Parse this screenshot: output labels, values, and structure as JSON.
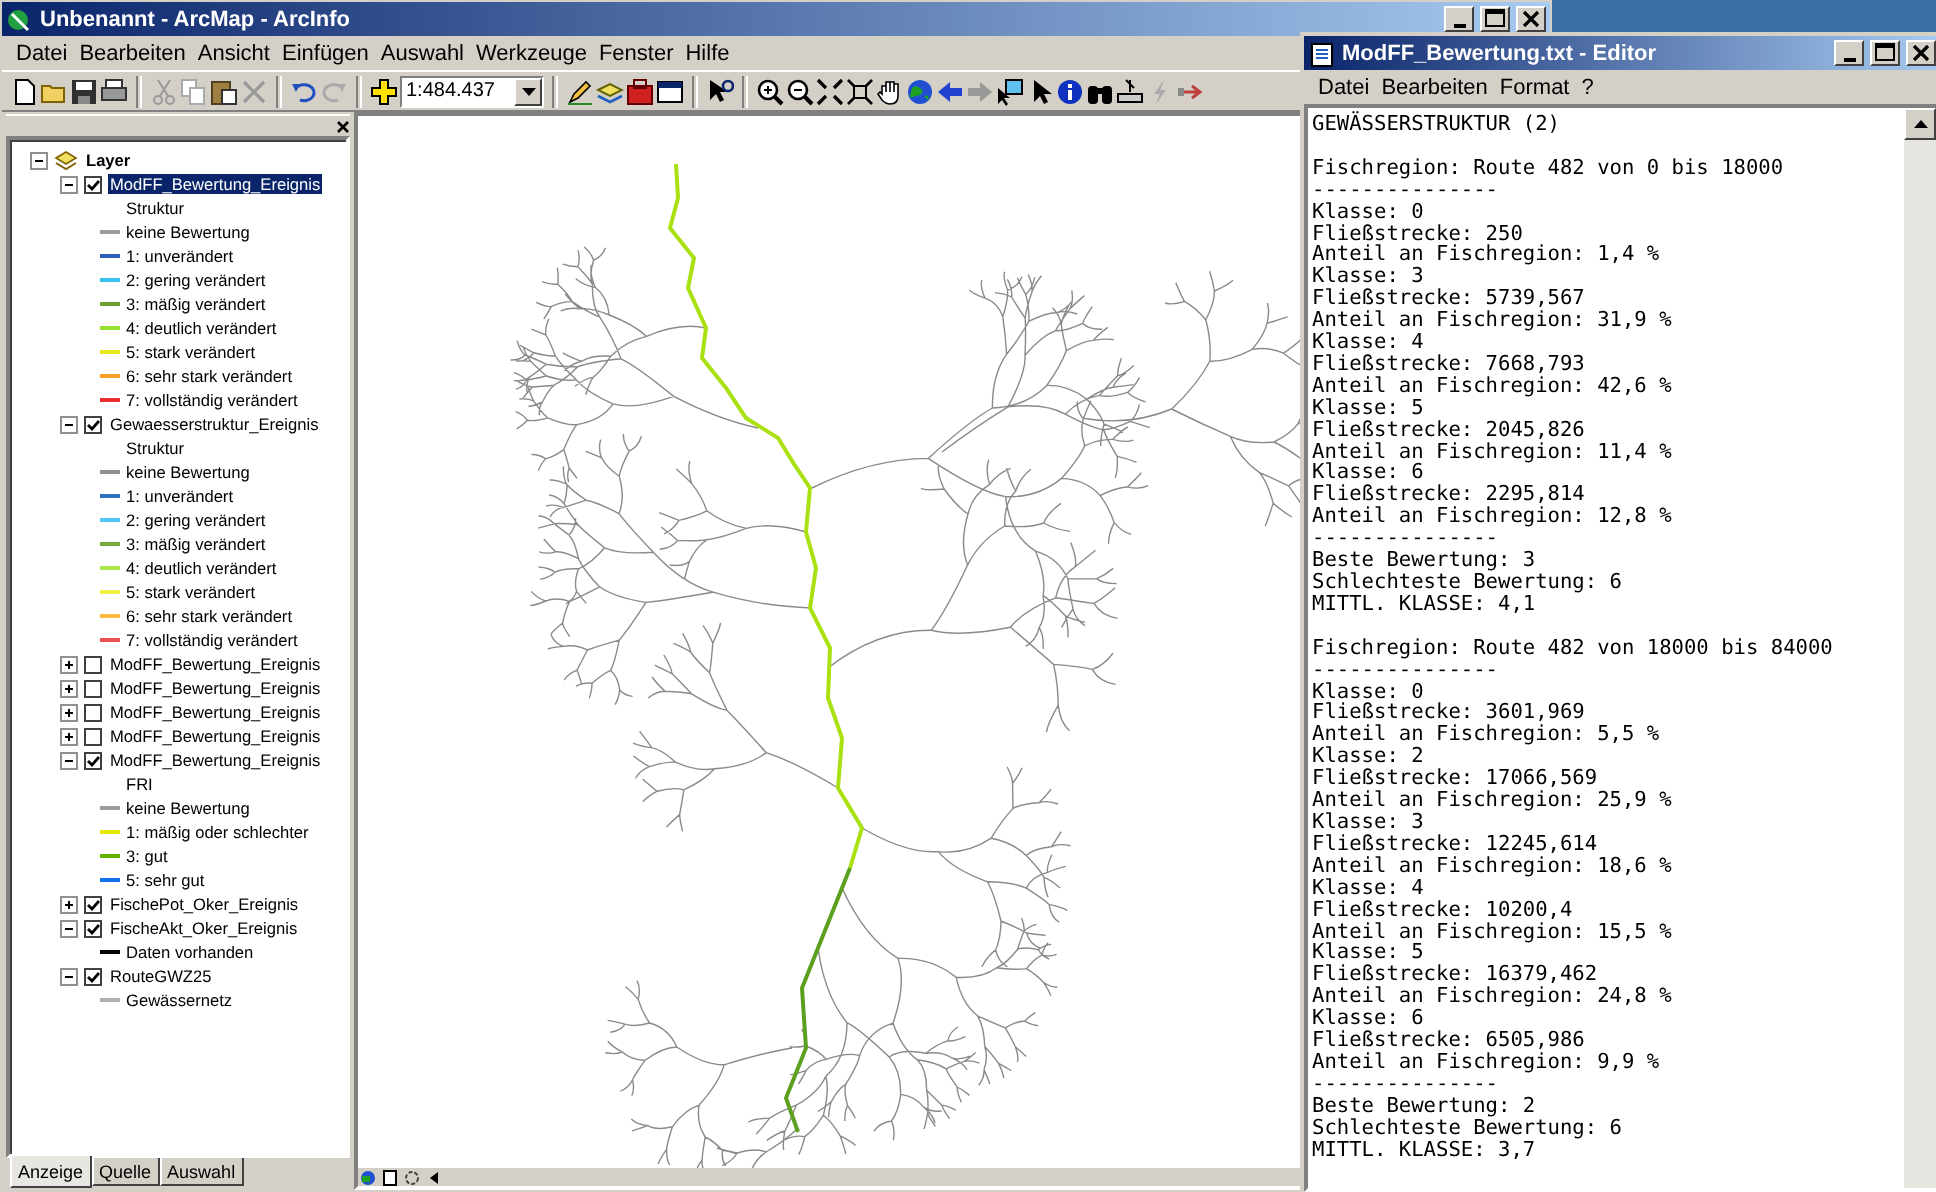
{
  "arcmap": {
    "title": "Unbenannt - ArcMap - ArcInfo",
    "menu": [
      "Datei",
      "Bearbeiten",
      "Ansicht",
      "Einfügen",
      "Auswahl",
      "Werkzeuge",
      "Fenster",
      "Hilfe"
    ],
    "scale": "1:484.437"
  },
  "toc": {
    "root": {
      "label": "Layer",
      "expanded": true
    },
    "layers": [
      {
        "name": "ModFF_Bewertung_Ereignis",
        "checked": true,
        "expanded": true,
        "selected": true,
        "heading": "Struktur",
        "legend": [
          {
            "label": "keine Bewertung",
            "color": "#9c9c9c"
          },
          {
            "label": "1: unverändert",
            "color": "#2a62b8"
          },
          {
            "label": "2: gering verändert",
            "color": "#38c0f0"
          },
          {
            "label": "3: mäßig verändert",
            "color": "#6aa02a"
          },
          {
            "label": "4: deutlich verändert",
            "color": "#98e030"
          },
          {
            "label": "5: stark verändert",
            "color": "#e8e81c"
          },
          {
            "label": "6: sehr stark verändert",
            "color": "#ffa020"
          },
          {
            "label": "7: vollständig verändert",
            "color": "#e83030"
          }
        ]
      },
      {
        "name": "Gewaesserstruktur_Ereignis",
        "checked": true,
        "expanded": true,
        "selected": false,
        "heading": "Struktur",
        "legend": [
          {
            "label": "keine Bewertung",
            "color": "#909090"
          },
          {
            "label": "1: unverändert",
            "color": "#3070c0"
          },
          {
            "label": "2: gering verändert",
            "color": "#50c8f8"
          },
          {
            "label": "3: mäßig verändert",
            "color": "#78a838"
          },
          {
            "label": "4: deutlich verändert",
            "color": "#a8e848"
          },
          {
            "label": "5: stark verändert",
            "color": "#f0f040"
          },
          {
            "label": "6: sehr stark verändert",
            "color": "#ffb840"
          },
          {
            "label": "7: vollständig verändert",
            "color": "#f05050"
          }
        ]
      },
      {
        "name": "ModFF_Bewertung_Ereignis",
        "checked": false,
        "expanded": false,
        "selected": false
      },
      {
        "name": "ModFF_Bewertung_Ereignis",
        "checked": false,
        "expanded": false,
        "selected": false
      },
      {
        "name": "ModFF_Bewertung_Ereignis",
        "checked": false,
        "expanded": false,
        "selected": false
      },
      {
        "name": "ModFF_Bewertung_Ereignis",
        "checked": false,
        "expanded": false,
        "selected": false
      },
      {
        "name": "ModFF_Bewertung_Ereignis",
        "checked": true,
        "expanded": true,
        "selected": false,
        "heading": "FRI",
        "legend": [
          {
            "label": "keine Bewertung",
            "color": "#9c9c9c"
          },
          {
            "label": "1: mäßig oder schlechter",
            "color": "#e8e800"
          },
          {
            "label": "3: gut",
            "color": "#60b000"
          },
          {
            "label": "5: sehr gut",
            "color": "#1070f0"
          }
        ]
      },
      {
        "name": "FischePot_Oker_Ereignis",
        "checked": true,
        "expanded": false,
        "selected": false
      },
      {
        "name": "FischeAkt_Oker_Ereignis",
        "checked": true,
        "expanded": true,
        "selected": false,
        "legend": [
          {
            "label": "Daten vorhanden",
            "color": "#000000"
          }
        ]
      },
      {
        "name": "RouteGWZ25",
        "checked": true,
        "expanded": true,
        "selected": false,
        "legend": [
          {
            "label": "Gewässernetz",
            "color": "#b0b0b0"
          }
        ]
      }
    ],
    "tabs": [
      {
        "label": "Anzeige",
        "selected": true
      },
      {
        "label": "Quelle",
        "selected": false
      },
      {
        "label": "Auswahl",
        "selected": false
      }
    ]
  },
  "editor": {
    "title": "ModFF_Bewertung.txt - Editor",
    "menu": [
      "Datei",
      "Bearbeiten",
      "Format",
      "?"
    ],
    "heading": "GEWÄSSERSTRUKTUR (2)",
    "sections": [
      {
        "lines": [
          "Fischregion: Route 482 von 0 bis 18000",
          "---------------",
          "Klasse: 0",
          "Fließstrecke: 250",
          "Anteil an Fischregion: 1,4 %",
          "Klasse: 3",
          "Fließstrecke: 5739,567",
          "Anteil an Fischregion: 31,9 %",
          "Klasse: 4",
          "Fließstrecke: 7668,793",
          "Anteil an Fischregion: 42,6 %",
          "Klasse: 5",
          "Fließstrecke: 2045,826",
          "Anteil an Fischregion: 11,4 %",
          "Klasse: 6",
          "Fließstrecke: 2295,814",
          "Anteil an Fischregion: 12,8 %",
          "---------------",
          "Beste Bewertung: 3",
          "Schlechteste Bewertung: 6",
          "MITTL. KLASSE: 4,1"
        ]
      },
      {
        "lines": [
          "Fischregion: Route 482 von 18000 bis 84000",
          "---------------",
          "Klasse: 0",
          "Fließstrecke: 3601,969",
          "Anteil an Fischregion: 5,5 %",
          "Klasse: 2",
          "Fließstrecke: 17066,569",
          "Anteil an Fischregion: 25,9 %",
          "Klasse: 3",
          "Fließstrecke: 12245,614",
          "Anteil an Fischregion: 18,6 %",
          "Klasse: 4",
          "Fließstrecke: 10200,4",
          "Anteil an Fischregion: 15,5 %",
          "Klasse: 5",
          "Fließstrecke: 16379,462",
          "Anteil an Fischregion: 24,8 %",
          "Klasse: 6",
          "Fließstrecke: 6505,986",
          "Anteil an Fischregion: 9,9 %",
          "---------------",
          "Beste Bewertung: 2",
          "Schlechteste Bewertung: 6",
          "MITTL. KLASSE: 3,7"
        ]
      }
    ]
  }
}
